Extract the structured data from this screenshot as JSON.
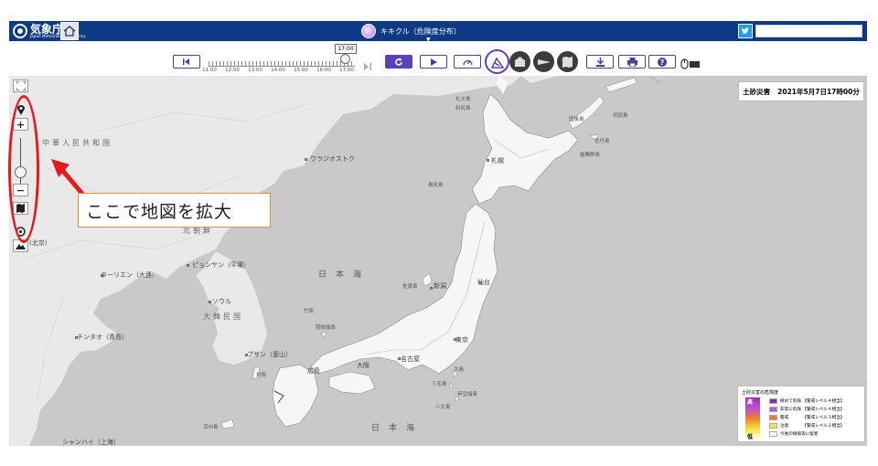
{
  "header": {
    "logo_jp": "気象庁",
    "logo_en": "Japan Meteorological Agency",
    "map_title": "キキクル（危険度分布）",
    "search_placeholder": ""
  },
  "toolbar": {
    "current_time_tip": "17:00",
    "time_ticks": [
      "11:00",
      "12:00",
      "13:00",
      "14:00",
      "15:00",
      "16:00",
      "17:00"
    ],
    "icons": [
      "skip-back-icon",
      "skip-forward-icon",
      "refresh-icon",
      "play-icon",
      "speed-icon",
      "kikikuru-landslide-icon",
      "weather-station-icon",
      "radar-icon",
      "map-layers-icon",
      "download-icon",
      "print-icon",
      "help-icon",
      "mouse-keyboard-icon"
    ]
  },
  "map": {
    "hazard_type": "土砂災害",
    "datetime": "2021年5月7日17時00分",
    "big_labels": {
      "sea_of_japan": "日本海",
      "japan_south": "日本海",
      "china": "中華人民共和国",
      "korea": "大韓民国",
      "north_korea": "北朝鮮"
    },
    "city_labels": [
      {
        "key": "vladivostok",
        "text": "ウラジオストク"
      },
      {
        "key": "pyongyang",
        "text": "ピョンヤン（平壌）"
      },
      {
        "key": "seoul",
        "text": "ソウル"
      },
      {
        "key": "dalian",
        "text": "ターリエン（大連）"
      },
      {
        "key": "qingdao",
        "text": "チンタオ（青島）"
      },
      {
        "key": "busan",
        "text": "プサン（釜山）"
      },
      {
        "key": "shanghai",
        "text": "シャンハイ（上海）"
      },
      {
        "key": "beijing",
        "text": "(北京)"
      },
      {
        "key": "sapporo",
        "text": "札幌"
      },
      {
        "key": "niigata",
        "text": "新潟"
      },
      {
        "key": "sendai",
        "text": "仙台"
      },
      {
        "key": "tokyo",
        "text": "東京"
      },
      {
        "key": "nagoya",
        "text": "名古屋"
      },
      {
        "key": "osaka",
        "text": "大阪"
      },
      {
        "key": "hiroshima",
        "text": "広島"
      }
    ],
    "small_labels": [
      {
        "key": "rebun",
        "text": "礼文島"
      },
      {
        "key": "rishiri",
        "text": "利尻島"
      },
      {
        "key": "kunashiri",
        "text": "国後島"
      },
      {
        "key": "etorofu",
        "text": "択捉島"
      },
      {
        "key": "shikotan",
        "text": "色丹島"
      },
      {
        "key": "habomai",
        "text": "歯舞群島"
      },
      {
        "key": "okushiri",
        "text": "奥尻島"
      },
      {
        "key": "sado",
        "text": "佐渡島"
      },
      {
        "key": "takeshima",
        "text": "竹島"
      },
      {
        "key": "oki",
        "text": "隠岐諸島"
      },
      {
        "key": "oshima",
        "text": "大島"
      },
      {
        "key": "miyake",
        "text": "三宅島"
      },
      {
        "key": "hachijo",
        "text": "八丈島"
      },
      {
        "key": "tsushima",
        "text": "対馬"
      },
      {
        "key": "jeju",
        "text": "済州島"
      },
      {
        "key": "izu",
        "text": "伊豆諸島"
      }
    ],
    "legend": {
      "title": "土砂災害の危険度",
      "high": "高",
      "low": "低",
      "rows": [
        {
          "color": "#8b2bb0",
          "label": "極めて危険 【警戒レベル４相当】"
        },
        {
          "color": "#c253e0",
          "label": "非常に危険 【警戒レベル４相当】"
        },
        {
          "color": "#f07d2c",
          "label": "警戒　　　 【警戒レベル３相当】"
        },
        {
          "color": "#f7e53a",
          "label": "注意　　　 【警戒レベル２相当】"
        },
        {
          "color": "#ffffff",
          "label": "今後の情報等に留意"
        }
      ]
    }
  },
  "annotation": {
    "callout_text": "ここで地図を拡大"
  }
}
